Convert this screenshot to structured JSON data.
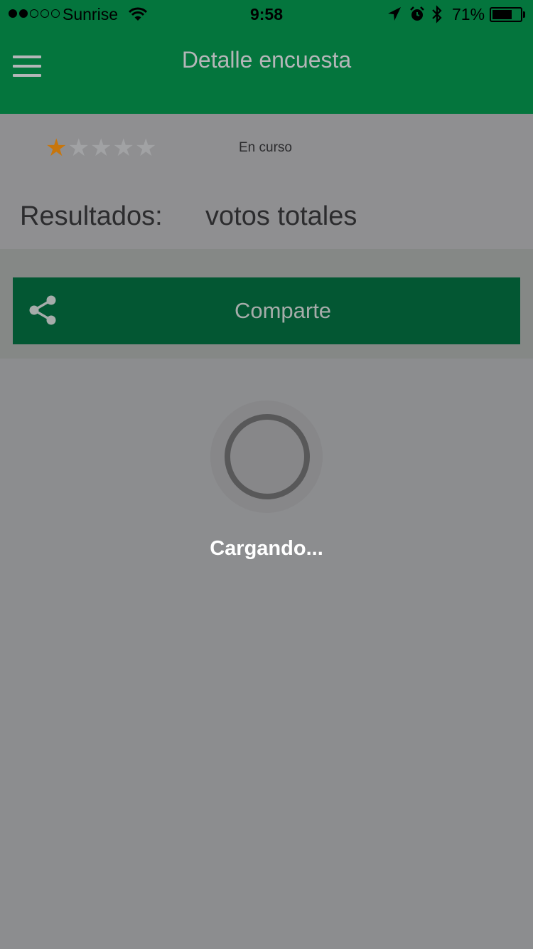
{
  "status_bar": {
    "carrier": "Sunrise",
    "signal_bars": 2,
    "signal_total": 5,
    "time": "9:58",
    "battery_percent": "71%",
    "battery_level": 0.71
  },
  "nav": {
    "title": "Detalle encuesta",
    "menu_icon": "hamburger-menu-icon",
    "color": "#04753d"
  },
  "poll": {
    "rating": 1,
    "rating_max": 5,
    "status": "En curso",
    "results_label": "Resultados:",
    "votes_label": "votos totales"
  },
  "share": {
    "label": "Comparte",
    "icon": "share-icon",
    "color": "#035733"
  },
  "loader": {
    "text": "Cargando..."
  },
  "colors": {
    "overlay": "#8c8d8f",
    "star_filled": "#c8760c"
  }
}
